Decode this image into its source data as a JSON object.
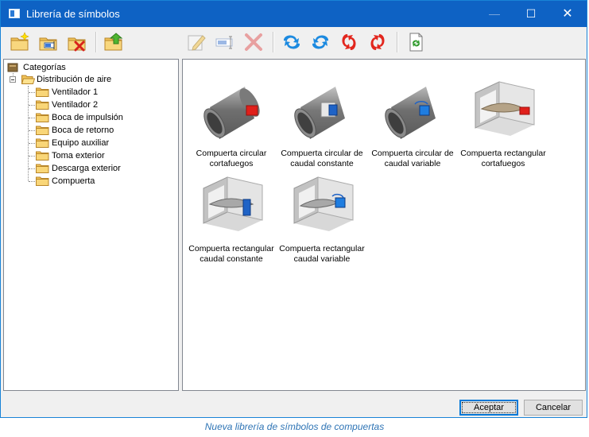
{
  "window": {
    "title": "Librería de símbolos",
    "minimize_glyph": "—",
    "maximize_glyph": "☐",
    "close_glyph": "✕",
    "accent": "#0e62c4"
  },
  "toolbar": {
    "buttons": [
      {
        "icon": "new-folder-icon"
      },
      {
        "icon": "rename-folder-icon"
      },
      {
        "icon": "delete-folder-icon"
      },
      {
        "icon": "folder-up-icon"
      },
      {
        "icon": "edit-symbol-icon"
      },
      {
        "icon": "rename-symbol-icon"
      },
      {
        "icon": "delete-symbol-icon"
      },
      {
        "icon": "rotate-cw-icon"
      },
      {
        "icon": "rotate-ccw-icon"
      },
      {
        "icon": "mirror-vertical-icon"
      },
      {
        "icon": "mirror-horizontal-icon"
      },
      {
        "icon": "refresh-icon"
      }
    ]
  },
  "tree": {
    "root": "Categorías",
    "group": "Distribución de aire",
    "items": [
      "Ventilador 1",
      "Ventilador 2",
      "Boca de impulsión",
      "Boca de retorno",
      "Equipo auxiliar",
      "Toma exterior",
      "Descarga exterior",
      "Compuerta"
    ]
  },
  "symbols": [
    {
      "line1": "Compuerta circular",
      "line2": "cortafuegos"
    },
    {
      "line1": "Compuerta circular de",
      "line2": "caudal constante"
    },
    {
      "line1": "Compuerta circular de",
      "line2": "caudal variable"
    },
    {
      "line1": "Compuerta rectangular",
      "line2": "cortafuegos"
    },
    {
      "line1": "Compuerta rectangular",
      "line2": "caudal constante"
    },
    {
      "line1": "Compuerta rectangular",
      "line2": "caudal variable"
    }
  ],
  "buttons": {
    "accept": "Aceptar",
    "cancel": "Cancelar"
  },
  "caption": "Nueva librería de símbolos de compuertas"
}
